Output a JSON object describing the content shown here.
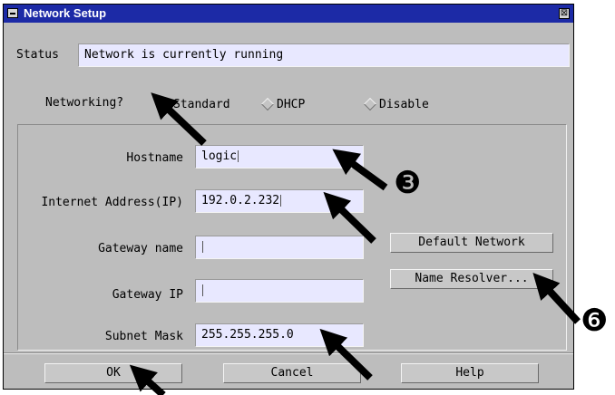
{
  "window": {
    "title": "Network Setup",
    "close_glyph": "⊠"
  },
  "status": {
    "label": "Status",
    "value": "Network is currently running"
  },
  "networking": {
    "label": "Networking?",
    "options": [
      {
        "label": "Standard",
        "selected": true
      },
      {
        "label": "DHCP",
        "selected": false
      },
      {
        "label": "Disable",
        "selected": false
      }
    ]
  },
  "fields": {
    "hostname": {
      "label": "Hostname",
      "value": "logic"
    },
    "ip": {
      "label": "Internet Address(IP)",
      "value": "192.0.2.232"
    },
    "gateway_name": {
      "label": "Gateway name",
      "value": ""
    },
    "gateway_ip": {
      "label": "Gateway IP",
      "value": ""
    },
    "subnet": {
      "label": "Subnet Mask",
      "value": "255.255.255.0"
    }
  },
  "side_buttons": {
    "default_network": "Default Network",
    "name_resolver": "Name Resolver..."
  },
  "footer": {
    "ok": "OK",
    "cancel": "Cancel",
    "help": "Help"
  },
  "callouts": {
    "three": "❸",
    "six": "❻"
  },
  "icons": {
    "system_menu": "system-menu-icon",
    "close": "close-icon",
    "arrow": "arrow-pointer-icon"
  },
  "colors": {
    "titlebar": "#1c2aa6",
    "window": "#bdbdbd",
    "field_bg": "#e8e8ff"
  }
}
